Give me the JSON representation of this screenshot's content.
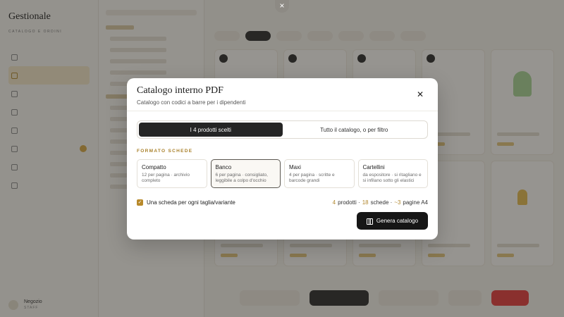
{
  "sidebar": {
    "brand": "Gestionale",
    "brand_sub": "CATALOGO E ORDINI",
    "user": {
      "name": "Negozio",
      "role": "STAFF"
    }
  },
  "modal": {
    "title": "Catalogo interno PDF",
    "subtitle": "Catalogo con codici a barre per i dipendenti",
    "scope": {
      "selected": "I 4 prodotti scelti",
      "alternative": "Tutto il catalogo, o per filtro"
    },
    "format_section": "FORMATO SCHEDE",
    "formats": [
      {
        "name": "Compatto",
        "desc": "12 per pagina · archivio completo",
        "selected": false
      },
      {
        "name": "Banco",
        "desc": "6 per pagina · consigliato, leggibile a colpo d'occhio",
        "selected": true
      },
      {
        "name": "Maxi",
        "desc": "4 per pagina · scritte e barcode grandi",
        "selected": false
      },
      {
        "name": "Cartellini",
        "desc": "da espositore · si ritagliano e si infilano sotto gli elastici",
        "selected": false
      }
    ],
    "variant_option": {
      "label": "Una scheda per ogni taglia/variante",
      "checked": true
    },
    "summary": {
      "products_count": "4",
      "products_label": "prodotti ·",
      "cards_count": "18",
      "cards_label": "schede ·",
      "pages": "~3",
      "pages_label": "pagine A4"
    },
    "generate_label": "Genera catalogo"
  },
  "colors": {
    "accent_gold": "#b0862c",
    "dark_button": "#161616",
    "overlay": "rgba(40,38,34,0.48)"
  },
  "icons": {
    "close": "close-icon",
    "generate": "book-open-icon",
    "checkbox": "check-icon"
  }
}
